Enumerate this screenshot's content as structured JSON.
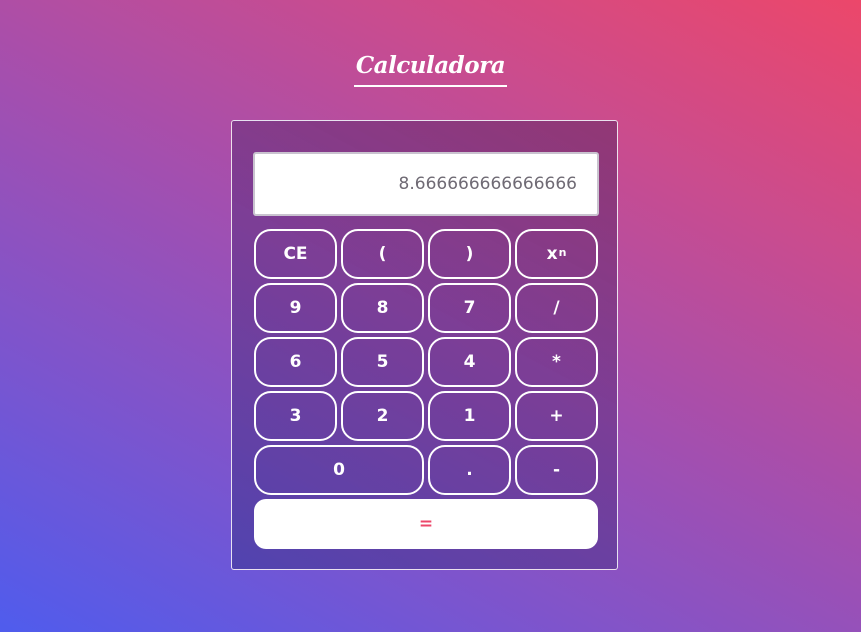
{
  "page": {
    "title": "Calculadora"
  },
  "display": {
    "value": "8.666666666666666"
  },
  "keys": {
    "clear": "CE",
    "open_paren": "(",
    "close_paren": ")",
    "power_base": "x",
    "power_exp": "n",
    "nine": "9",
    "eight": "8",
    "seven": "7",
    "divide": "/",
    "six": "6",
    "five": "5",
    "four": "4",
    "multiply": "*",
    "three": "3",
    "two": "2",
    "one": "1",
    "add": "+",
    "zero": "0",
    "decimal": ".",
    "subtract": "-",
    "equals": "="
  },
  "colors": {
    "gradient_start": "#4f5ced",
    "gradient_end": "#ec476a",
    "equals_text": "#ec476a",
    "display_text": "#6f6a74",
    "key_border": "#ffffff"
  }
}
